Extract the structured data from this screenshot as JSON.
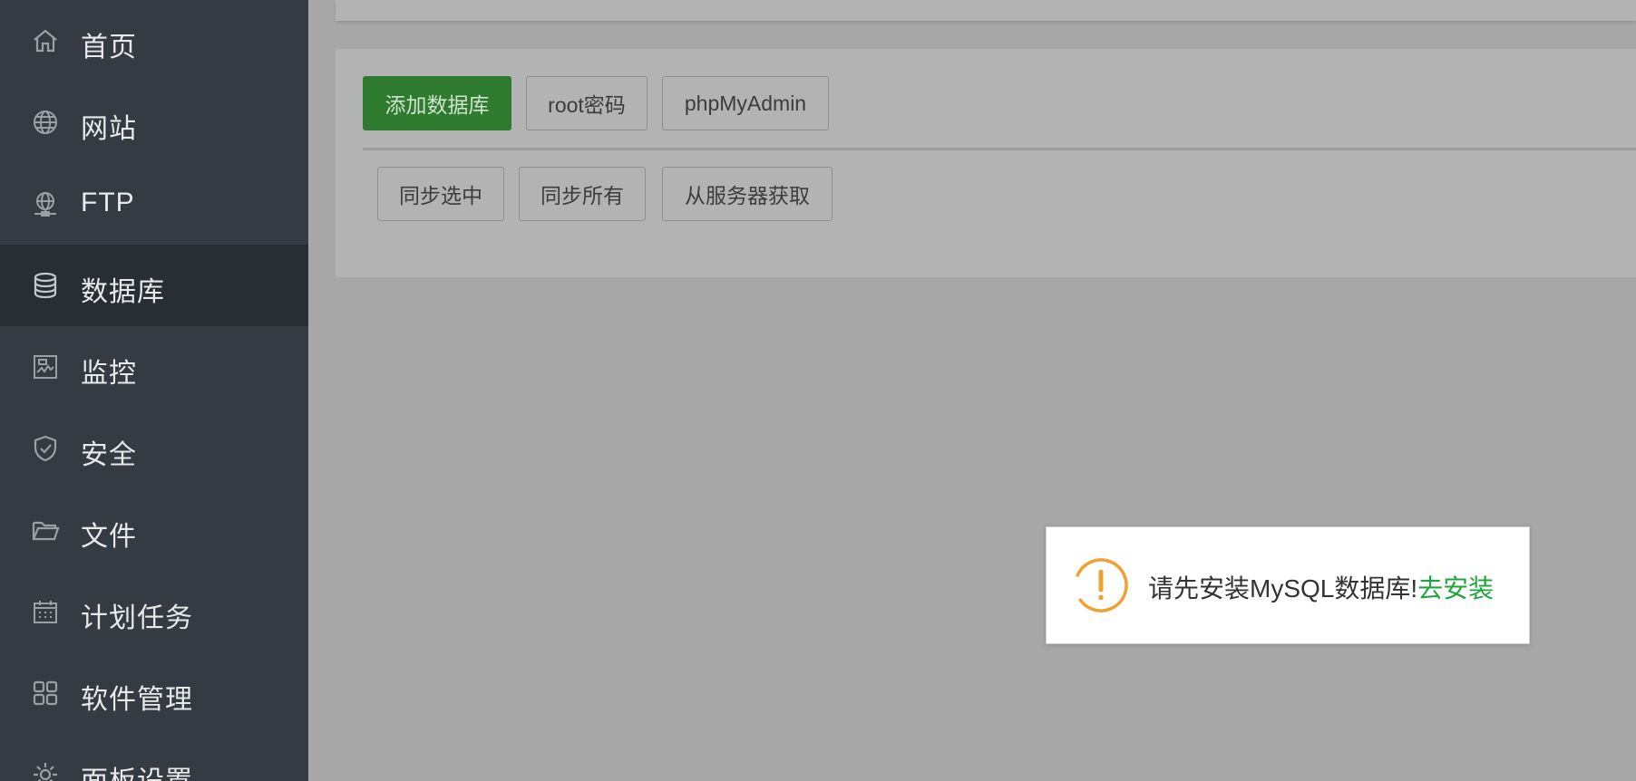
{
  "sidebar": {
    "items": [
      {
        "label": "首页",
        "icon": "home-icon"
      },
      {
        "label": "网站",
        "icon": "globe-icon"
      },
      {
        "label": "FTP",
        "icon": "ftp-icon"
      },
      {
        "label": "数据库",
        "icon": "database-icon",
        "active": true
      },
      {
        "label": "监控",
        "icon": "monitor-icon"
      },
      {
        "label": "安全",
        "icon": "shield-icon"
      },
      {
        "label": "文件",
        "icon": "folder-icon"
      },
      {
        "label": "计划任务",
        "icon": "calendar-icon"
      },
      {
        "label": "软件管理",
        "icon": "apps-icon"
      },
      {
        "label": "面板设置",
        "icon": "gear-icon"
      }
    ]
  },
  "toolbar": {
    "add_database_label": "添加数据库",
    "root_password_label": "root密码",
    "phpmyadmin_label": "phpMyAdmin",
    "sync_selected_label": "同步选中",
    "sync_all_label": "同步所有",
    "fetch_from_server_label": "从服务器获取"
  },
  "toast": {
    "message": "请先安装MySQL数据库!",
    "link_label": "去安装",
    "icon": "warning-icon"
  },
  "colors": {
    "sidebar_bg": "#343b42",
    "sidebar_active_bg": "#292e34",
    "primary_button": "#2e7a2f",
    "link": "#20a53a",
    "warning": "#f0a133"
  }
}
